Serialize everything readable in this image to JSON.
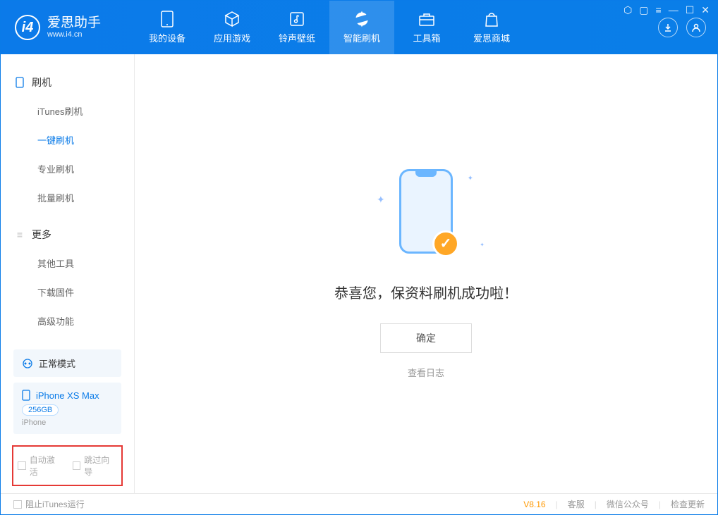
{
  "app": {
    "name": "爱思助手",
    "url": "www.i4.cn"
  },
  "nav": {
    "items": [
      {
        "label": "我的设备"
      },
      {
        "label": "应用游戏"
      },
      {
        "label": "铃声壁纸"
      },
      {
        "label": "智能刷机"
      },
      {
        "label": "工具箱"
      },
      {
        "label": "爱思商城"
      }
    ]
  },
  "sidebar": {
    "section1": {
      "title": "刷机",
      "items": [
        "iTunes刷机",
        "一键刷机",
        "专业刷机",
        "批量刷机"
      ]
    },
    "section2": {
      "title": "更多",
      "items": [
        "其他工具",
        "下载固件",
        "高级功能"
      ]
    },
    "mode": "正常模式",
    "device": {
      "name": "iPhone XS Max",
      "capacity": "256GB",
      "type": "iPhone"
    },
    "checks": {
      "auto_activate": "自动激活",
      "skip_wizard": "跳过向导"
    }
  },
  "main": {
    "success_text": "恭喜您，保资料刷机成功啦！",
    "ok_button": "确定",
    "view_log": "查看日志"
  },
  "footer": {
    "block_itunes": "阻止iTunes运行",
    "version": "V8.16",
    "support": "客服",
    "wechat": "微信公众号",
    "check_update": "检查更新"
  }
}
